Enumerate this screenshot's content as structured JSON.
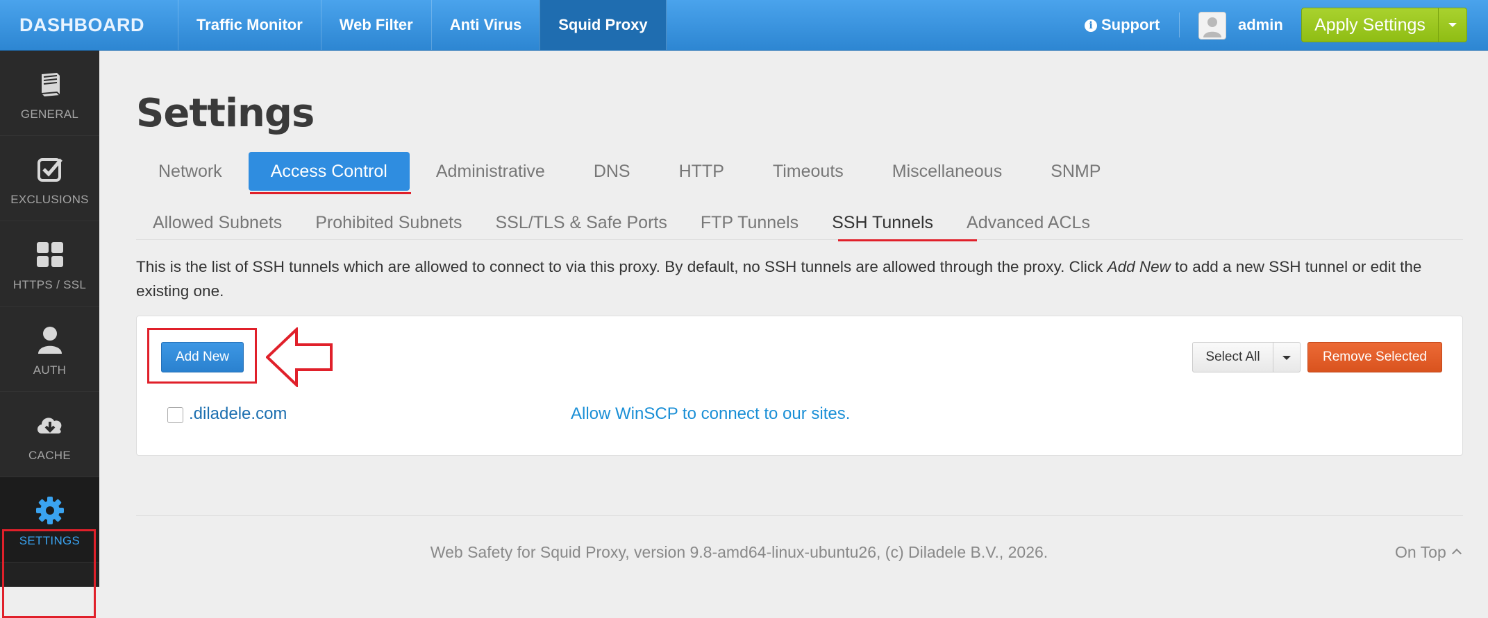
{
  "app": {
    "brand": "DASHBOARD",
    "nav": [
      "Traffic Monitor",
      "Web Filter",
      "Anti Virus",
      "Squid Proxy"
    ],
    "active_nav": "Squid Proxy",
    "support_label": "Support",
    "user_label": "admin",
    "apply_label": "Apply Settings"
  },
  "sidebar": {
    "items": [
      {
        "label": "GENERAL",
        "icon": "book-icon"
      },
      {
        "label": "EXCLUSIONS",
        "icon": "checkbox-icon"
      },
      {
        "label": "HTTPS / SSL",
        "icon": "grid-icon"
      },
      {
        "label": "AUTH",
        "icon": "user-icon"
      },
      {
        "label": "CACHE",
        "icon": "cloud-download-icon"
      },
      {
        "label": "SETTINGS",
        "icon": "gear-icon"
      }
    ],
    "active": "SETTINGS"
  },
  "page": {
    "title": "Settings",
    "tabs": [
      "Network",
      "Access Control",
      "Administrative",
      "DNS",
      "HTTP",
      "Timeouts",
      "Miscellaneous",
      "SNMP"
    ],
    "active_tab": "Access Control",
    "subtabs": [
      "Allowed Subnets",
      "Prohibited Subnets",
      "SSL/TLS & Safe Ports",
      "FTP Tunnels",
      "SSH Tunnels",
      "Advanced ACLs"
    ],
    "active_subtab": "SSH Tunnels",
    "description_part1": "This is the list of SSH tunnels which are allowed to connect to via this proxy. By default, no SSH tunnels are allowed through the proxy. Click ",
    "description_em": "Add New",
    "description_part2": " to add a new SSH tunnel or edit the existing one.",
    "add_new_label": "Add New",
    "select_all_label": "Select All",
    "remove_selected_label": "Remove Selected",
    "rows": [
      {
        "name": ".diladele.com",
        "description": "Allow WinSCP to connect to our sites."
      }
    ],
    "footer": "Web Safety for Squid Proxy, version 9.8-amd64-linux-ubuntu26, (c) Diladele B.V., 2026.",
    "on_top_label": "On Top"
  },
  "colors": {
    "topbar": "#2d86d2",
    "accent_blue": "#2f8de0",
    "apply_green": "#8fbd14",
    "remove_orange": "#d9531e",
    "highlight_red": "#e0202a"
  }
}
